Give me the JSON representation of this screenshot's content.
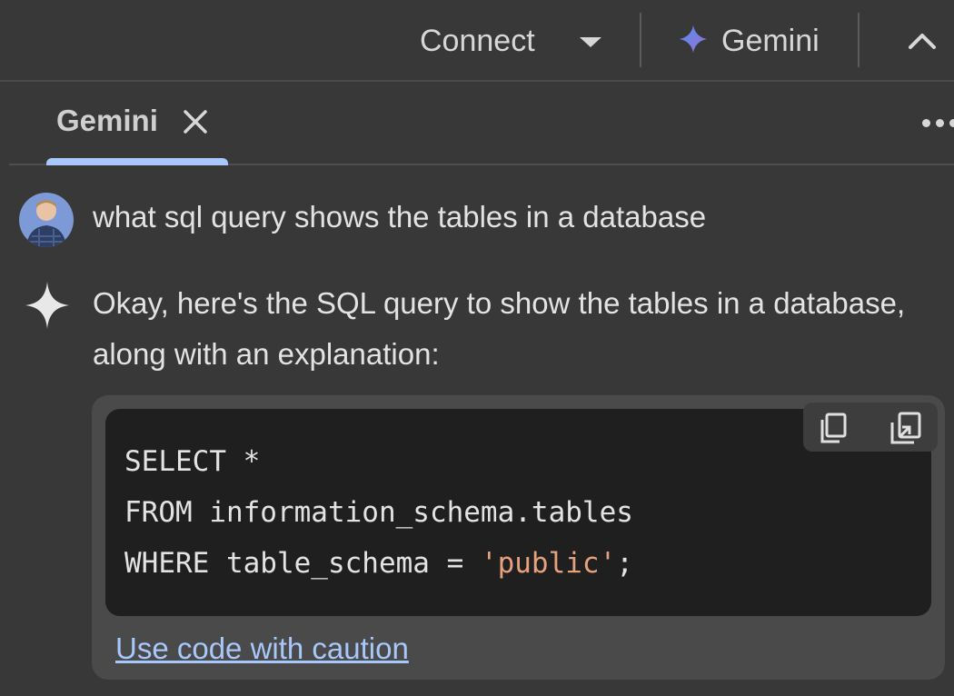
{
  "header": {
    "connect_label": "Connect",
    "gemini_label": "Gemini"
  },
  "tabs": [
    {
      "label": "Gemini",
      "active": true
    }
  ],
  "chat": {
    "user_message": "what sql query shows the tables in a database",
    "ai_message": "Okay, here's the SQL query to show the tables in a database, along with an explanation:",
    "code": {
      "line1": "SELECT *",
      "line2": "FROM information_schema.tables",
      "line3_prefix": "WHERE table_schema = ",
      "line3_string": "'public'",
      "line3_suffix": ";"
    },
    "caution_link": "Use code with caution"
  },
  "colors": {
    "background": "#383838",
    "accent": "#a8c7fa",
    "code_bg": "#1f1f1f",
    "string": "#e6a27c"
  },
  "icons": [
    "chevron-down-icon",
    "gemini-sparkle-icon",
    "chevron-up-icon",
    "close-icon",
    "more-horiz-icon",
    "copy-icon",
    "insert-code-icon"
  ]
}
